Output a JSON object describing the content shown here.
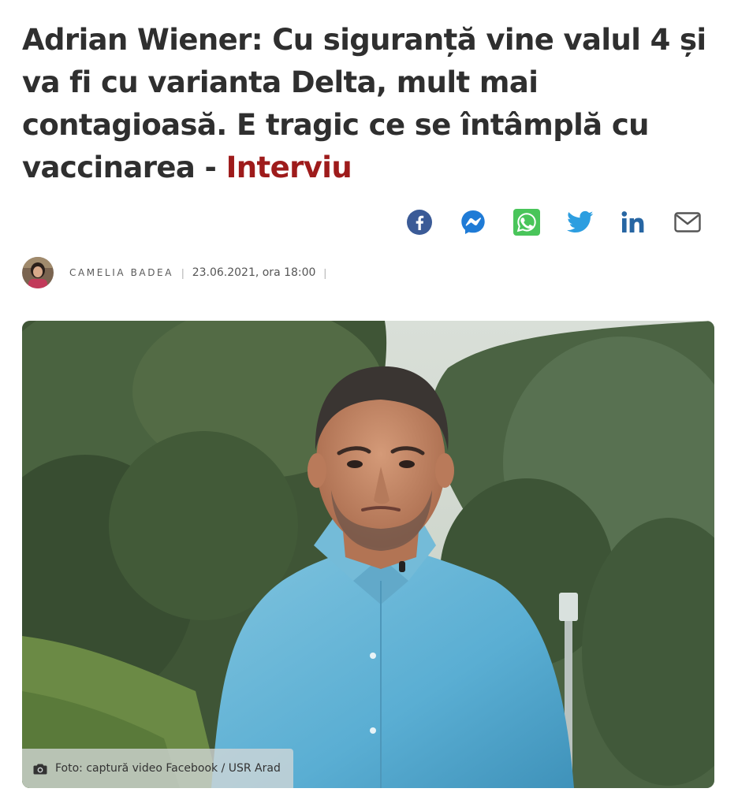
{
  "article": {
    "title": "Adrian Wiener: Cu siguranță vine valul 4 și va fi cu varianta Delta, mult mai contagioasă. E tragic ce se întâmplă cu vaccinarea - ",
    "title_tag": "Interviu",
    "tag_color": "#9e1b1b"
  },
  "share": {
    "buttons": [
      {
        "icon": "facebook-icon",
        "color": "#3b5b97"
      },
      {
        "icon": "messenger-icon",
        "color": "#1f7bd6"
      },
      {
        "icon": "whatsapp-icon",
        "color": "#49c55a"
      },
      {
        "icon": "twitter-icon",
        "color": "#2d9ee0"
      },
      {
        "icon": "linkedin-icon",
        "color": "#2766a3"
      },
      {
        "icon": "email-icon",
        "color": "#555555"
      }
    ]
  },
  "byline": {
    "author": "Camelia Badea",
    "separator": "|",
    "date": "23.06.2021, ora 18:00"
  },
  "hero": {
    "caption": "Foto: captură video Facebook / USR Arad",
    "caption_icon": "camera-icon"
  }
}
